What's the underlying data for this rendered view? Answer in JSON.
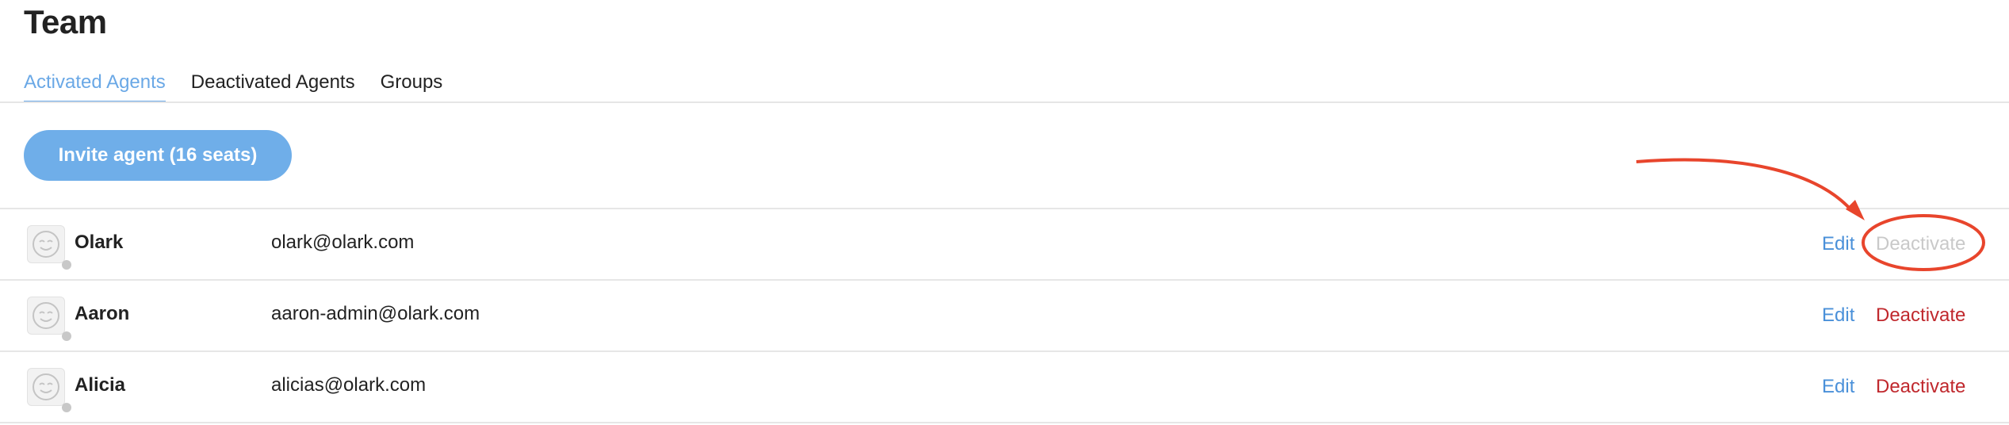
{
  "page": {
    "title": "Team"
  },
  "tabs": [
    {
      "label": "Activated Agents",
      "active": true
    },
    {
      "label": "Deactivated Agents",
      "active": false
    },
    {
      "label": "Groups",
      "active": false
    }
  ],
  "invite_button": {
    "label": "Invite agent (16 seats)"
  },
  "agents": [
    {
      "name": "Olark",
      "email": "olark@olark.com",
      "edit_label": "Edit",
      "deactivate_label": "Deactivate",
      "deactivate_disabled": true,
      "status": "offline"
    },
    {
      "name": "Aaron",
      "email": "aaron-admin@olark.com",
      "edit_label": "Edit",
      "deactivate_label": "Deactivate",
      "deactivate_disabled": false,
      "status": "offline"
    },
    {
      "name": "Alicia",
      "email": "alicias@olark.com",
      "edit_label": "Edit",
      "deactivate_label": "Deactivate",
      "deactivate_disabled": false,
      "status": "offline"
    }
  ],
  "colors": {
    "accent": "#6aa8e6",
    "link": "#4a90d9",
    "danger": "#c0282d",
    "disabled": "#c9c9c9",
    "annotation": "#e8452c"
  },
  "icons": {
    "avatar": "smiley-face-icon",
    "annotation": "red-arrow-annotation"
  }
}
